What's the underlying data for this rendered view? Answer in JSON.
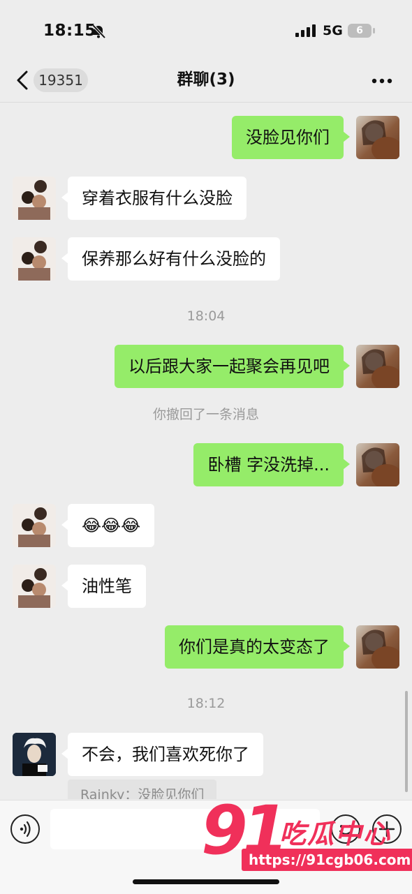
{
  "status_bar": {
    "time": "18:15",
    "network": "5G",
    "battery": "6"
  },
  "nav": {
    "unread_count": "19351",
    "title": "群聊(3)"
  },
  "chat": {
    "messages": [
      {
        "from": "self",
        "text": "没脸见你们"
      },
      {
        "from": "group-member",
        "text": "穿着衣服有什么没脸"
      },
      {
        "from": "group-member",
        "text": "保养那么好有什么没脸的"
      },
      {
        "from": "self",
        "text": "以后跟大家一起聚会再见吧"
      },
      {
        "from": "self",
        "text": "卧槽 字没洗掉..."
      },
      {
        "from": "group-member",
        "text": "😂😂😂"
      },
      {
        "from": "group-member",
        "text": "油性笔"
      },
      {
        "from": "self",
        "text": "你们是真的太变态了"
      },
      {
        "from": "other-member",
        "text": "不会，我们喜欢死你了"
      }
    ],
    "timestamps": [
      "18:04",
      "18:12"
    ],
    "system_note": "你撤回了一条消息",
    "quote": "Rainky：没脸见你们"
  },
  "watermark": {
    "number": "91",
    "text": "吃瓜中心",
    "url": "https://91cgb06.com"
  },
  "colors": {
    "self_bubble": "#95ec69",
    "other_bubble": "#ffffff",
    "background": "#ededed",
    "watermark": "#f0305a"
  }
}
